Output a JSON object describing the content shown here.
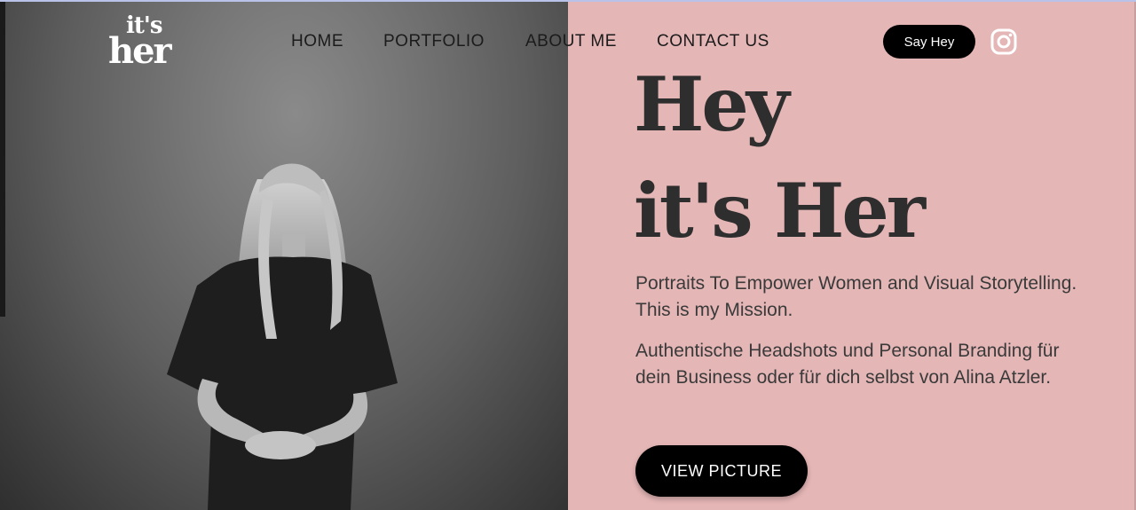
{
  "brand": {
    "logo_top": "it's",
    "logo_bottom": "her"
  },
  "nav": {
    "items": [
      {
        "label": "HOME"
      },
      {
        "label": "PORTFOLIO"
      },
      {
        "label": "ABOUT ME"
      },
      {
        "label": "CONTACT US"
      }
    ],
    "cta_label": "Say Hey",
    "social_icon": "instagram-icon"
  },
  "hero": {
    "title_line1": "Hey",
    "title_line2": "it's Her",
    "paragraph1": "Portraits To Empower Women and Visual Storytelling. This is my Mission.",
    "paragraph2": "Authentische Headshots und Personal Branding für dein Business oder für dich selbst von Alina Atzler.",
    "button_label": "VIEW PICTURE"
  },
  "colors": {
    "accent_panel": "#e5b6b6",
    "text_dark": "#2e2e2e",
    "button_bg": "#000000",
    "button_text": "#ffffff"
  }
}
